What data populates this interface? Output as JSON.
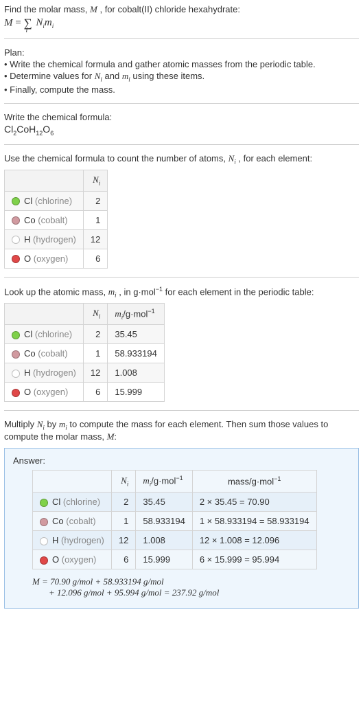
{
  "intro": {
    "line1_a": "Find the molar mass, ",
    "line1_b": ", for cobalt(II) chloride hexahydrate:",
    "M": "M",
    "sum_eq_1": "M",
    "sum_eq_2": " = ",
    "sum_eq_sigma": "∑",
    "sum_eq_i": "i",
    "sum_eq_Ni": "N",
    "sum_eq_mi": "m"
  },
  "plan": {
    "title": "Plan:",
    "p1_a": "• Write the chemical formula and gather atomic masses from the periodic table.",
    "p2_a": "• Determine values for ",
    "p2_b": " and ",
    "p2_c": " using these items.",
    "p3_a": "• Finally, compute the mass."
  },
  "chem": {
    "title": "Write the chemical formula:",
    "f_Cl": "Cl",
    "f_2": "2",
    "f_Co": "Co",
    "f_H": "H",
    "f_12": "12",
    "f_O": "O",
    "f_6": "6"
  },
  "count": {
    "line_a": "Use the chemical formula to count the number of atoms, ",
    "line_b": ", for each element:",
    "Ni_head": "N",
    "i_head": "i",
    "rows": [
      {
        "sym": "Cl",
        "name": "(chlorine)",
        "N": "2"
      },
      {
        "sym": "Co",
        "name": "(cobalt)",
        "N": "1"
      },
      {
        "sym": "H",
        "name": "(hydrogen)",
        "N": "12"
      },
      {
        "sym": "O",
        "name": "(oxygen)",
        "N": "6"
      }
    ]
  },
  "mass": {
    "line_a": "Look up the atomic mass, ",
    "line_b": ", in g·mol",
    "line_c": " for each element in the periodic table:",
    "neg1": "−1",
    "head_m": "m",
    "head_unit": "/g·mol",
    "rows": [
      {
        "sym": "Cl",
        "name": "(chlorine)",
        "N": "2",
        "m": "35.45"
      },
      {
        "sym": "Co",
        "name": "(cobalt)",
        "N": "1",
        "m": "58.933194"
      },
      {
        "sym": "H",
        "name": "(hydrogen)",
        "N": "12",
        "m": "1.008"
      },
      {
        "sym": "O",
        "name": "(oxygen)",
        "N": "6",
        "m": "15.999"
      }
    ]
  },
  "mult": {
    "line_a": "Multiply ",
    "line_b": " by ",
    "line_c": " to compute the mass for each element. Then sum those values to compute the molar mass, ",
    "line_d": ":"
  },
  "answer": {
    "title": "Answer:",
    "head_mass": "mass/g·mol",
    "rows": [
      {
        "sym": "Cl",
        "name": "(chlorine)",
        "N": "2",
        "m": "35.45",
        "calc": "2 × 35.45 = 70.90"
      },
      {
        "sym": "Co",
        "name": "(cobalt)",
        "N": "1",
        "m": "58.933194",
        "calc": "1 × 58.933194 = 58.933194"
      },
      {
        "sym": "H",
        "name": "(hydrogen)",
        "N": "12",
        "m": "1.008",
        "calc": "12 × 1.008 = 12.096"
      },
      {
        "sym": "O",
        "name": "(oxygen)",
        "N": "6",
        "m": "15.999",
        "calc": "6 × 15.999 = 95.994"
      }
    ],
    "f1": "M = 70.90 g/mol + 58.933194 g/mol",
    "f2": "+ 12.096 g/mol + 95.994 g/mol = 237.92 g/mol"
  }
}
